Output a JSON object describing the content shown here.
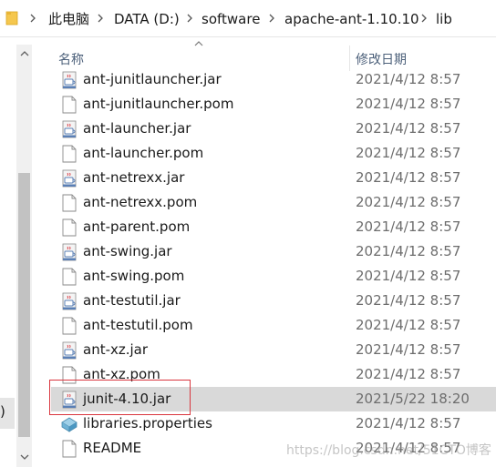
{
  "breadcrumb": {
    "items": [
      "此电脑",
      "DATA (D:)",
      "software",
      "apache-ant-1.10.10",
      "lib"
    ]
  },
  "columns": {
    "name": "名称",
    "date_modified": "修改日期"
  },
  "files": [
    {
      "name": "ant-junitlauncher.jar",
      "date": "2021/4/12 8:57",
      "type": "jar"
    },
    {
      "name": "ant-junitlauncher.pom",
      "date": "2021/4/12 8:57",
      "type": "pom"
    },
    {
      "name": "ant-launcher.jar",
      "date": "2021/4/12 8:57",
      "type": "jar"
    },
    {
      "name": "ant-launcher.pom",
      "date": "2021/4/12 8:57",
      "type": "pom"
    },
    {
      "name": "ant-netrexx.jar",
      "date": "2021/4/12 8:57",
      "type": "jar"
    },
    {
      "name": "ant-netrexx.pom",
      "date": "2021/4/12 8:57",
      "type": "pom"
    },
    {
      "name": "ant-parent.pom",
      "date": "2021/4/12 8:57",
      "type": "pom"
    },
    {
      "name": "ant-swing.jar",
      "date": "2021/4/12 8:57",
      "type": "jar"
    },
    {
      "name": "ant-swing.pom",
      "date": "2021/4/12 8:57",
      "type": "pom"
    },
    {
      "name": "ant-testutil.jar",
      "date": "2021/4/12 8:57",
      "type": "jar"
    },
    {
      "name": "ant-testutil.pom",
      "date": "2021/4/12 8:57",
      "type": "pom"
    },
    {
      "name": "ant-xz.jar",
      "date": "2021/4/12 8:57",
      "type": "jar"
    },
    {
      "name": "ant-xz.pom",
      "date": "2021/4/12 8:57",
      "type": "pom"
    },
    {
      "name": "junit-4.10.jar",
      "date": "2021/5/22 18:20",
      "type": "jar",
      "selected": true
    },
    {
      "name": "libraries.properties",
      "date": "2021/4/12 8:57",
      "type": "properties"
    },
    {
      "name": "README",
      "date": "2021/4/12 8:57",
      "type": "file"
    }
  ],
  "nav_pane": {
    "edge_text": ")"
  },
  "watermark": "https://blog.csdn.net/51CTO博客",
  "colors": {
    "selected_row": "#d9d9d9",
    "highlight_box": "#d9363e",
    "header_text": "#4c607a",
    "date_text": "#6d6d6d"
  }
}
